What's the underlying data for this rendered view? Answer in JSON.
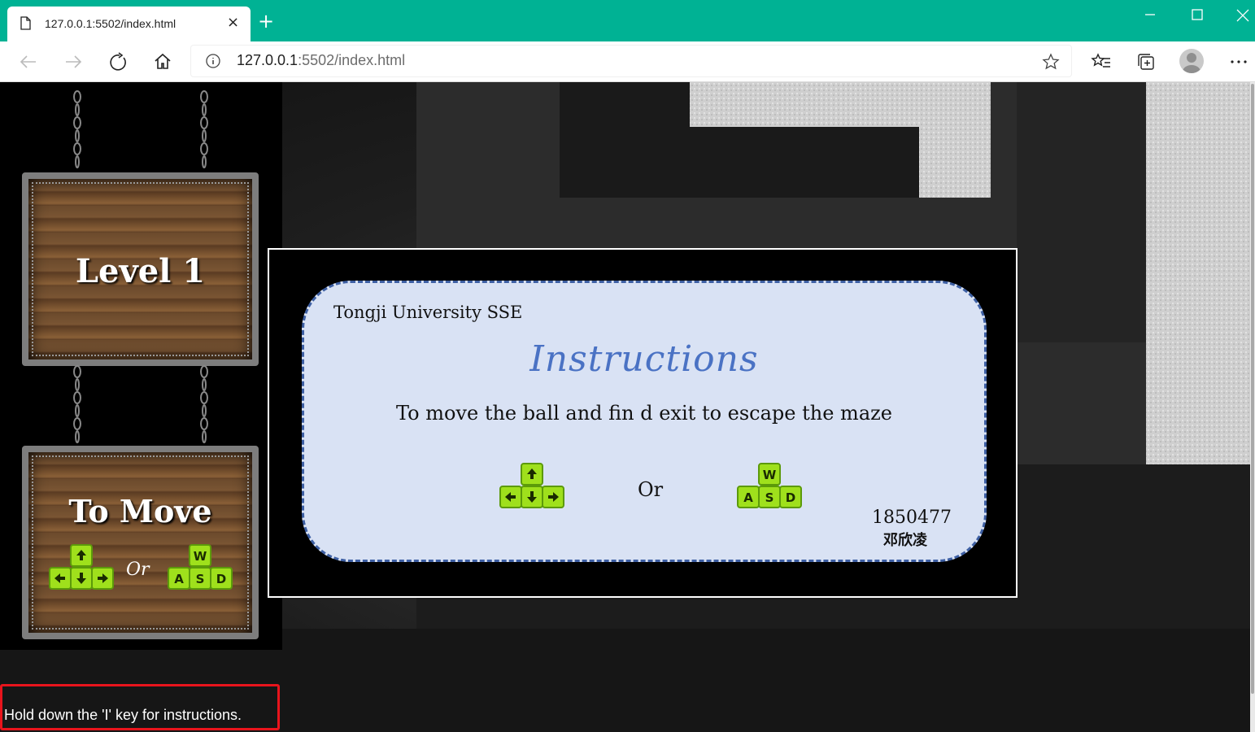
{
  "browser": {
    "tab_title": "127.0.0.1:5502/index.html",
    "tab_close": "×",
    "new_tab": "+",
    "url_host": "127.0.0.1",
    "url_path": ":5502/index.html",
    "accent_color": "#00b294"
  },
  "signs": {
    "level_label": "Level 1",
    "move_label": "To Move",
    "or_label": "Or",
    "arrow_keys_icon": "arrow-keys-icon",
    "wasd_keys_icon": "wasd-keys-icon"
  },
  "modal": {
    "org": "Tongji University  SSE",
    "title": "Instructions",
    "description": "To move the ball and fin d exit to escape the maze",
    "or_label": "Or",
    "student_id": "1850477",
    "student_name": "邓欣凌"
  },
  "hint": {
    "text": "Hold down the 'I' key for instructions.",
    "highlight_color": "#e8141c"
  }
}
